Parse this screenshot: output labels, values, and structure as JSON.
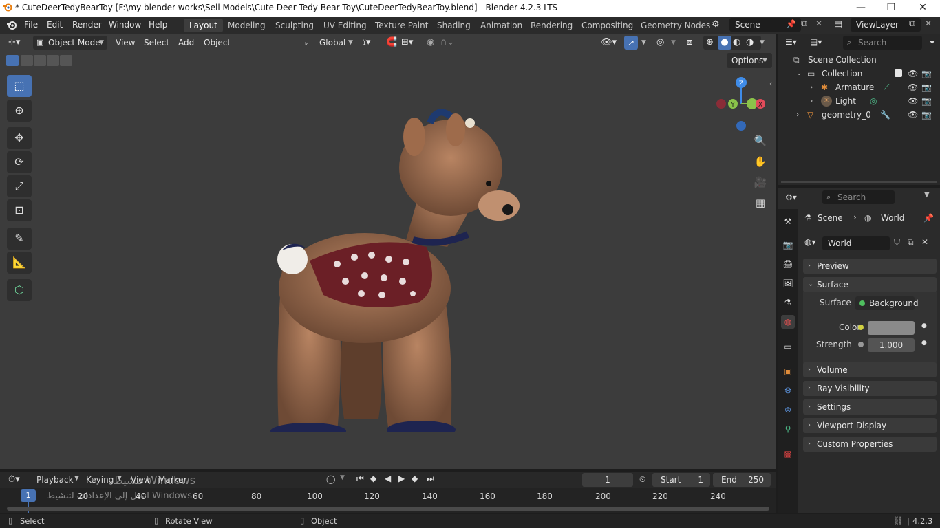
{
  "window": {
    "title": "* CuteDeerTedyBearToy [F:\\my blender works\\Sell Models\\Cute Deer Tedy Bear Toy\\CuteDeerTedyBearToy.blend] - Blender 4.2.3 LTS",
    "minimize": "—",
    "maximize": "❐",
    "close": "✕"
  },
  "menubar": {
    "file": "File",
    "edit": "Edit",
    "render": "Render",
    "window": "Window",
    "help": "Help"
  },
  "workspaces": [
    "Layout",
    "Modeling",
    "Sculpting",
    "UV Editing",
    "Texture Paint",
    "Shading",
    "Animation",
    "Rendering",
    "Compositing",
    "Geometry Nodes"
  ],
  "active_workspace": "Layout",
  "scene": {
    "name": "Scene",
    "view_layer": "ViewLayer"
  },
  "viewport_header": {
    "mode": "Object Mode",
    "view": "View",
    "select": "Select",
    "add": "Add",
    "object": "Object",
    "orientation": "Global",
    "options": "Options"
  },
  "gizmo": {
    "x": "X",
    "y": "Y",
    "z": "Z"
  },
  "outliner": {
    "search_placeholder": "Search",
    "root": "Scene Collection",
    "items": [
      {
        "label": "Collection"
      },
      {
        "label": "Armature"
      },
      {
        "label": "Light"
      },
      {
        "label": "geometry_0"
      }
    ]
  },
  "properties": {
    "search_placeholder": "Search",
    "breadcrumb_scene": "Scene",
    "breadcrumb_world": "World",
    "world_name": "World",
    "panels": {
      "preview": "Preview",
      "surface": "Surface",
      "volume": "Volume",
      "ray_visibility": "Ray Visibility",
      "settings": "Settings",
      "viewport_display": "Viewport Display",
      "custom_properties": "Custom Properties"
    },
    "surface_label": "Surface",
    "surface_value": "Background",
    "color_label": "Color",
    "color_value": "#8a8a8a",
    "strength_label": "Strength",
    "strength_value": "1.000"
  },
  "timeline": {
    "playback": "Playback",
    "keying": "Keying",
    "view": "View",
    "marker": "Marker",
    "current_frame": "1",
    "start_label": "Start",
    "start_value": "1",
    "end_label": "End",
    "end_value": "250",
    "ticks": [
      "20",
      "40",
      "60",
      "80",
      "100",
      "120",
      "140",
      "160",
      "180",
      "200",
      "220",
      "240"
    ],
    "playhead": "1"
  },
  "watermark": {
    "line1": "تنشيط Windows",
    "line2": "انتقل إلى الإعدادات لتنشيط Windows."
  },
  "statusbar": {
    "select": "Select",
    "rotate_view": "Rotate View",
    "object": "Object",
    "version": "4.2.3"
  },
  "colors": {
    "accent": "#4772b3",
    "viewport_bg": "#3c3c3c",
    "panel_bg": "#2b2b2b",
    "axis_x": "#e24b5a",
    "axis_y": "#8bc34a",
    "axis_z": "#3f8ce8"
  }
}
